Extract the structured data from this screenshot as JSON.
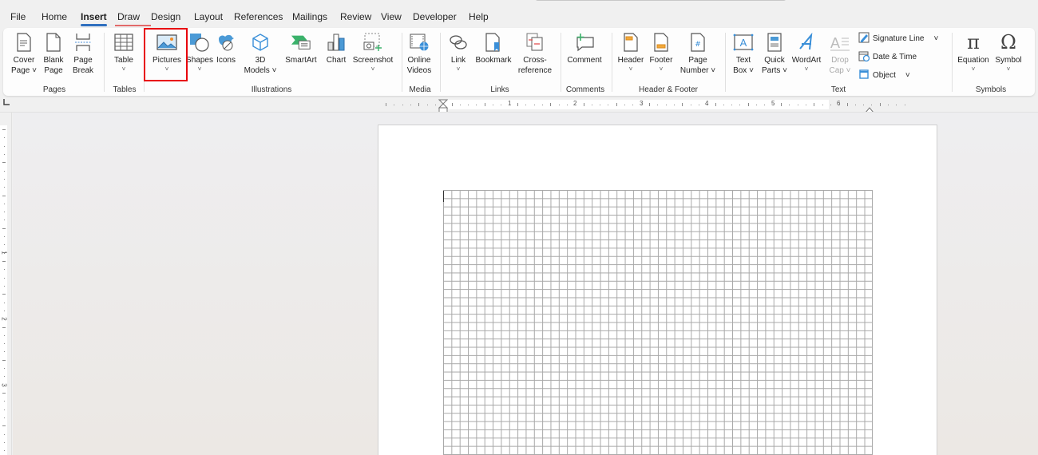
{
  "menubar": {
    "tabs": [
      {
        "label": "File"
      },
      {
        "label": "Home"
      },
      {
        "label": "Insert",
        "active": true
      },
      {
        "label": "Draw"
      },
      {
        "label": "Design"
      },
      {
        "label": "Layout"
      },
      {
        "label": "References"
      },
      {
        "label": "Mailings"
      },
      {
        "label": "Review"
      },
      {
        "label": "View"
      },
      {
        "label": "Developer"
      },
      {
        "label": "Help"
      }
    ]
  },
  "ribbon": {
    "groups": {
      "pages": "Pages",
      "tables": "Tables",
      "illustrations": "Illustrations",
      "media": "Media",
      "links": "Links",
      "comments": "Comments",
      "header_footer": "Header & Footer",
      "text": "Text",
      "symbols": "Symbols"
    },
    "buttons": {
      "cover_page": [
        "Cover",
        "Page ˅"
      ],
      "blank_page": [
        "Blank",
        "Page"
      ],
      "page_break": [
        "Page",
        "Break"
      ],
      "table": "Table",
      "pictures": "Pictures",
      "shapes": "Shapes",
      "icons": "Icons",
      "models_3d": [
        "3D",
        "Models ˅"
      ],
      "smartart": "SmartArt",
      "chart": "Chart",
      "screenshot": "Screenshot",
      "online_videos": [
        "Online",
        "Videos"
      ],
      "link": "Link",
      "bookmark": "Bookmark",
      "cross_reference": [
        "Cross-",
        "reference"
      ],
      "comment": "Comment",
      "header": "Header",
      "footer": "Footer",
      "page_number": [
        "Page",
        "Number ˅"
      ],
      "text_box": [
        "Text",
        "Box ˅"
      ],
      "quick_parts": [
        "Quick",
        "Parts ˅"
      ],
      "wordart": "WordArt",
      "drop_cap": [
        "Drop",
        "Cap ˅"
      ],
      "signature_line": "Signature Line",
      "date_time": "Date & Time",
      "object": "Object",
      "equation": "Equation",
      "symbol": "Symbol"
    },
    "chevron": "˅",
    "highlighted_button": "Pictures",
    "highlight_color": "#e8000b"
  },
  "ruler": {
    "horizontal_numbers": [
      "1",
      "2",
      "3",
      "4",
      "5",
      "6"
    ],
    "vertical_numbers": [
      "1",
      "2",
      "3"
    ]
  },
  "colors": {
    "accent": "#2f6fbf",
    "highlight": "#e8000b",
    "grid_line": "#a8a8a8"
  }
}
